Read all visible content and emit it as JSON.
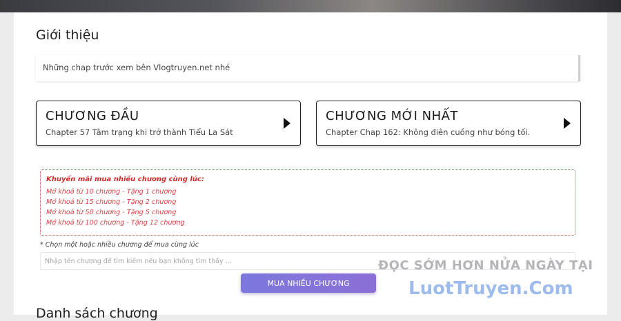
{
  "intro": {
    "title": "Giới thiệu",
    "text": "Những chap trước xem bên Vlogtruyen.net nhé"
  },
  "chapters": {
    "first": {
      "heading": "CHƯƠNG ĐẦU",
      "subtitle": "Chapter 57 Tâm trạng khi trở thành Tiểu La Sát"
    },
    "latest": {
      "heading": "CHƯƠNG MỚI NHẤT",
      "subtitle": "Chapter Chap 162: Không điên cuồng như bóng tối."
    }
  },
  "promo": {
    "title": "Khuyến mãi mua nhiều chương cùng lúc:",
    "items": [
      "Mở khoá từ 10 chương - Tặng 1 chương",
      "Mở khoá từ 15 chương - Tặng 2 chương",
      "Mở khoá từ 50 chương - Tặng 5 chương",
      "Mở khoá từ 100 chương - Tặng 12 chương"
    ]
  },
  "multi_buy": {
    "hint": "* Chọn một hoặc nhiều chương để mua cùng lúc",
    "search_placeholder": "Nhập tên chương để tìm kiếm nếu bạn không tìm thấy ...",
    "button_label": "MUA NHIỀU CHƯƠNG"
  },
  "next_section_title": "Danh sách chương",
  "watermark": {
    "line1": "ĐỌC SỚM HƠN NỬA NGÀY TẠI",
    "line2": "LuotTruyen.Com"
  },
  "colors": {
    "promo_red": "#d02a2a",
    "button_purple": "#7c78dc",
    "watermark_blue": "#3c78dc"
  }
}
